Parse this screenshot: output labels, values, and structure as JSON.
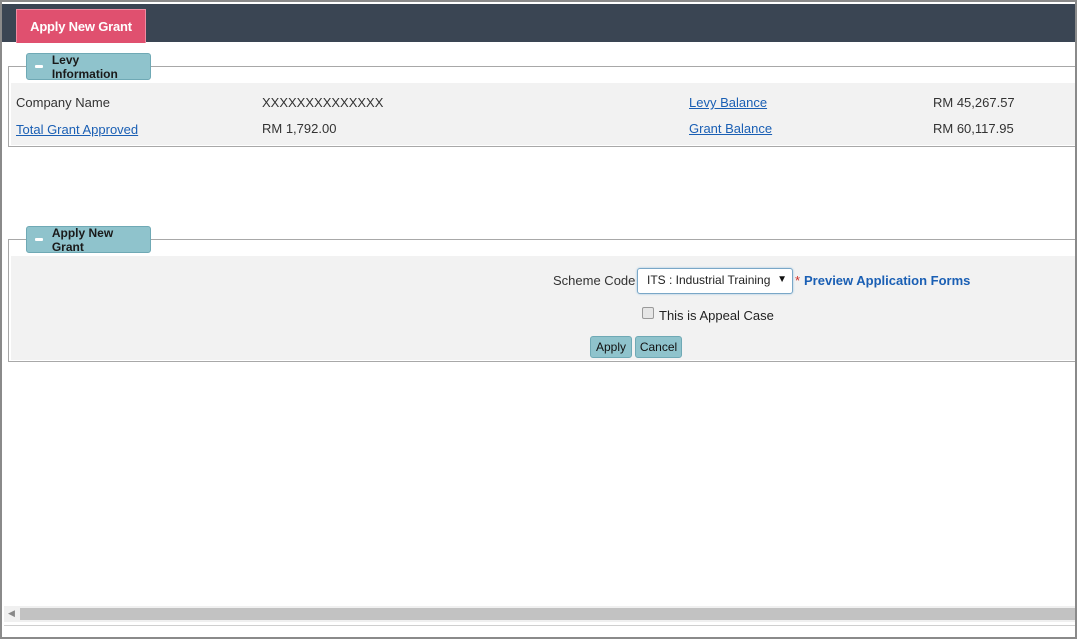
{
  "header": {
    "active_tab": "Apply New Grant",
    "bar_color": "#3a4553",
    "tab_color": "#e0506f"
  },
  "levy_section": {
    "legend": "Levy Information",
    "legend_icon": "minus-icon",
    "company_name_label": "Company Name",
    "company_name_value": "XXXXXXXXXXXXXX",
    "total_grant_approved_label": "Total Grant Approved",
    "total_grant_approved_value": "RM 1,792.00",
    "levy_balance_label": "Levy Balance",
    "levy_balance_value": "RM 45,267.57",
    "grant_balance_label": "Grant Balance",
    "grant_balance_value": "RM 60,117.95"
  },
  "apply_section": {
    "legend": "Apply New Grant",
    "legend_icon": "minus-icon",
    "scheme_code_label": "Scheme Code",
    "scheme_code_selected": "ITS : Industrial Training S",
    "required_marker": "*",
    "preview_link": "Preview Application Forms",
    "appeal_checkbox_label": "This is Appeal Case",
    "appeal_checked": false,
    "apply_button": "Apply",
    "cancel_button": "Cancel"
  },
  "accent_colors": {
    "legend_bg": "#8fc3cc",
    "link": "#1a5fb4",
    "required": "#d0302a"
  }
}
